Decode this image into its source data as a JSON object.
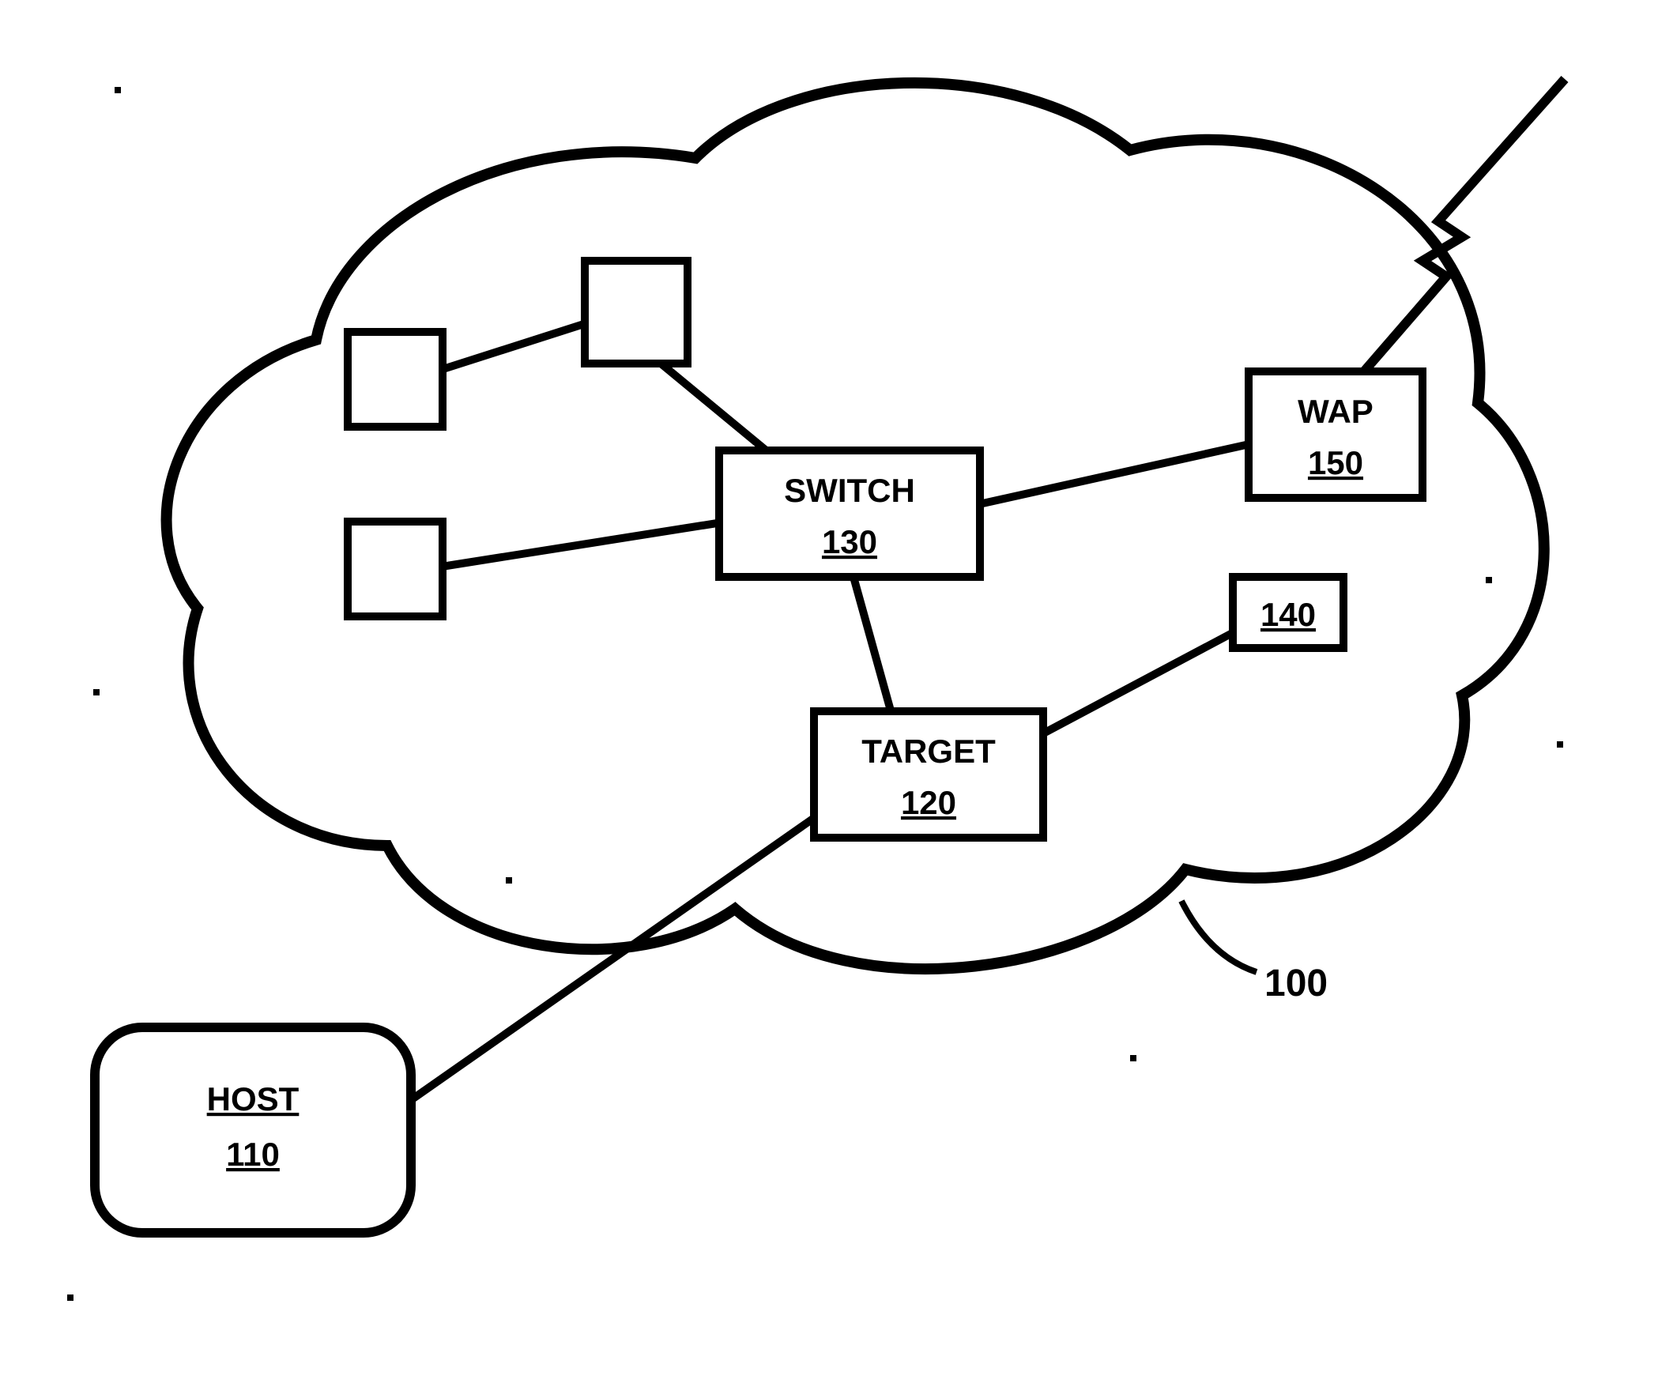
{
  "figure": {
    "reference_number": "100"
  },
  "nodes": {
    "host": {
      "label": "HOST",
      "number": "110"
    },
    "target": {
      "label": "TARGET",
      "number": "120"
    },
    "switch": {
      "label": "SWITCH",
      "number": "130"
    },
    "box140": {
      "number": "140"
    },
    "wap": {
      "label": "WAP",
      "number": "150"
    }
  }
}
